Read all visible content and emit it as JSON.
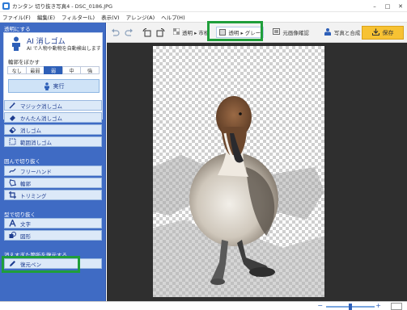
{
  "window": {
    "title": "カンタン 切り抜き写真4 - DSC_0186.JPG",
    "controls": {
      "minimize": "–",
      "maximize": "□",
      "close": "✕"
    }
  },
  "menu": [
    "ファイル(F)",
    "編集(E)",
    "フィルター(L)",
    "表示(V)",
    "アレンジ(A)",
    "ヘルプ(H)"
  ],
  "sidebar": {
    "transparent_section": "透明にする",
    "ai_card": {
      "title": "AI 消しゴム",
      "description": "AI で人物や動物を自動検出します",
      "blur_label": "輪郭をぼかす",
      "blur_options": [
        "なし",
        "最弱",
        "弱",
        "中",
        "強"
      ],
      "blur_selected": "弱",
      "execute_label": "実行"
    },
    "tools": [
      {
        "label": "マジック消しゴム",
        "icon": "magic-wand-icon"
      },
      {
        "label": "かんたん消しゴム",
        "icon": "easy-eraser-icon"
      },
      {
        "label": "消しゴム",
        "icon": "eraser-icon"
      },
      {
        "label": "範囲消しゴム",
        "icon": "range-eraser-icon"
      }
    ],
    "cut_section": "囲んで切り抜く",
    "cut_tools": [
      {
        "label": "フリーハンド",
        "icon": "freehand-icon"
      },
      {
        "label": "輪郭",
        "icon": "outline-icon"
      },
      {
        "label": "トリミング",
        "icon": "crop-icon"
      }
    ],
    "shape_section": "型で切り抜く",
    "shape_tools": [
      {
        "label": "文字",
        "icon": "text-icon"
      },
      {
        "label": "図形",
        "icon": "shape-icon"
      }
    ],
    "restore_section": "消えすぎた箇所を復元する",
    "restore_tools": [
      {
        "label": "復元ペン",
        "icon": "pen-icon"
      }
    ]
  },
  "toolbar": {
    "undo": "undo-icon",
    "redo": "redo-icon",
    "rotate_left": "rotate-left-icon",
    "rotate_right": "rotate-right-icon",
    "check_label": "透明 ▸ 市松",
    "gray_label": "透明 ▸ グレー",
    "original_label": "元画像確認",
    "compose_label": "写真と合成",
    "save_label": "保存"
  },
  "colors": {
    "sidebar_bg": "#3f6bc4",
    "highlight": "#1f9e3a",
    "save_button": "#f7c233",
    "canvas_bg": "#2f2f2f"
  }
}
